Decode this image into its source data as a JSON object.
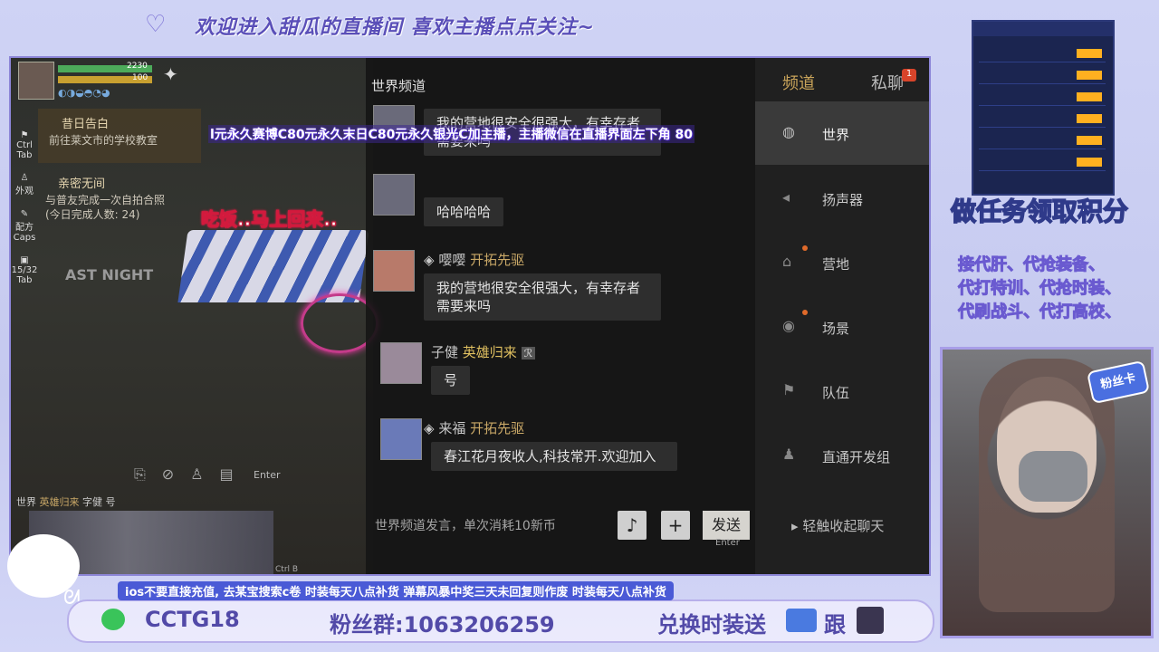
{
  "banner": "欢迎进入甜瓜的直播间  喜欢主播点点关注~",
  "ticker_in": "l元永久赛博C80元永久末日C80元永久银光C加主播，主播微信在直播界面左下角 80",
  "brb_sticker": "吃饭..马上回来..",
  "hud": {
    "hp_value": "2230",
    "stat_value": "100",
    "quest1_title": "昔日告白",
    "quest1_sub": "前往莱文市的学校教室",
    "quest2_title": "亲密无间",
    "quest2_sub": "与普友完成一次自拍合照",
    "quest2_progress": "(今日完成人数: 24)",
    "side_labels": [
      "Ctrl Tab",
      "外观",
      "配方 Caps",
      "15/32 Tab"
    ],
    "wall_sign": "AST NIGHT",
    "enter_label": "Enter",
    "channel_tag": "世界",
    "channel_name": "英雄归来",
    "channel_msg": "字健 号",
    "ctrl_b": "Ctrl B"
  },
  "chat": {
    "title": "世界频道",
    "messages": [
      {
        "name": "",
        "tag": "",
        "text": "我的营地很安全很强大，有幸存者需要来吗"
      },
      {
        "name": "",
        "tag": "",
        "text": "哈哈哈哈"
      },
      {
        "name": "嘤嘤",
        "tag": "开拓先驱",
        "text": "我的营地很安全很强大，有幸存者需要来吗"
      },
      {
        "name": "子健",
        "tag": "英雄归来",
        "text": "号"
      },
      {
        "name": "来福",
        "tag": "开拓先驱",
        "text": "春江花月夜收人,科技常开.欢迎加入"
      }
    ],
    "input_placeholder": "世界频道发言，单次消耗10新币",
    "send": "发送",
    "send_hint": "Enter"
  },
  "nav": {
    "tab_channel": "频道",
    "tab_private": "私聊",
    "private_badge": "1",
    "items": [
      "世界",
      "扬声器",
      "营地",
      "场景",
      "队伍",
      "直通开发组"
    ],
    "collapse": "轻触收起聊天"
  },
  "side": {
    "task_caption": "做任务领取积分",
    "services": [
      "接代肝、代抢装备、",
      "代打特训、代抢时装、",
      "代刷战斗、代打高校、"
    ],
    "fan_badge": "粉丝卡"
  },
  "bottom": {
    "ticker": "ios不要直接充值, 去某宝搜索c卷     时装每天八点补货     弹幕风暴中奖三天未回复则作废     时装每天八点补货",
    "wechat": "CCTG18",
    "fans_group": "粉丝群:1063206259",
    "exchange": "兑换时装送",
    "follow": "跟"
  },
  "colors": {
    "accent": "#5a4fb8",
    "nav_gold": "#c8a35a",
    "overlay_bg": "#c8cdf0"
  }
}
